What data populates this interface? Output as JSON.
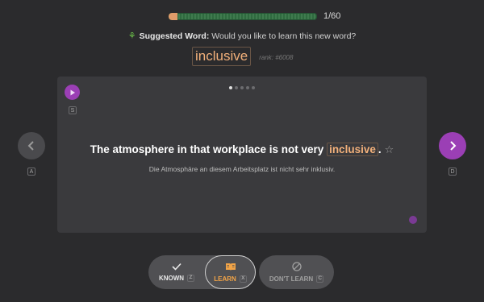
{
  "progress": {
    "current": 1,
    "total": 60,
    "label": "1/60",
    "fill_fraction": 0.0167
  },
  "suggestion": {
    "title": "Suggested Word:",
    "prompt": "Would you like to learn this new word?"
  },
  "word": {
    "text": "inclusive",
    "rank": "rank: #6008"
  },
  "card": {
    "play_key": "S",
    "dots_total": 5,
    "dots_active_index": 0,
    "sentence_before": "The atmosphere in that workplace is not very ",
    "sentence_highlight": "inclusive",
    "sentence_after": ".",
    "translation": "Die Atmosphäre an diesem Arbeitsplatz ist nicht sehr inklusiv."
  },
  "nav": {
    "prev_key": "A",
    "next_key": "D"
  },
  "actions": {
    "known": {
      "label": "KNOWN",
      "key": "Z"
    },
    "learn": {
      "label": "LEARN",
      "key": "X"
    },
    "dont_learn": {
      "label": "DON'T LEARN",
      "key": "C"
    }
  },
  "colors": {
    "accent": "#9b3fb5",
    "highlight": "#f2b07a",
    "learn": "#f2a447",
    "progress": "#3f7a4e"
  }
}
